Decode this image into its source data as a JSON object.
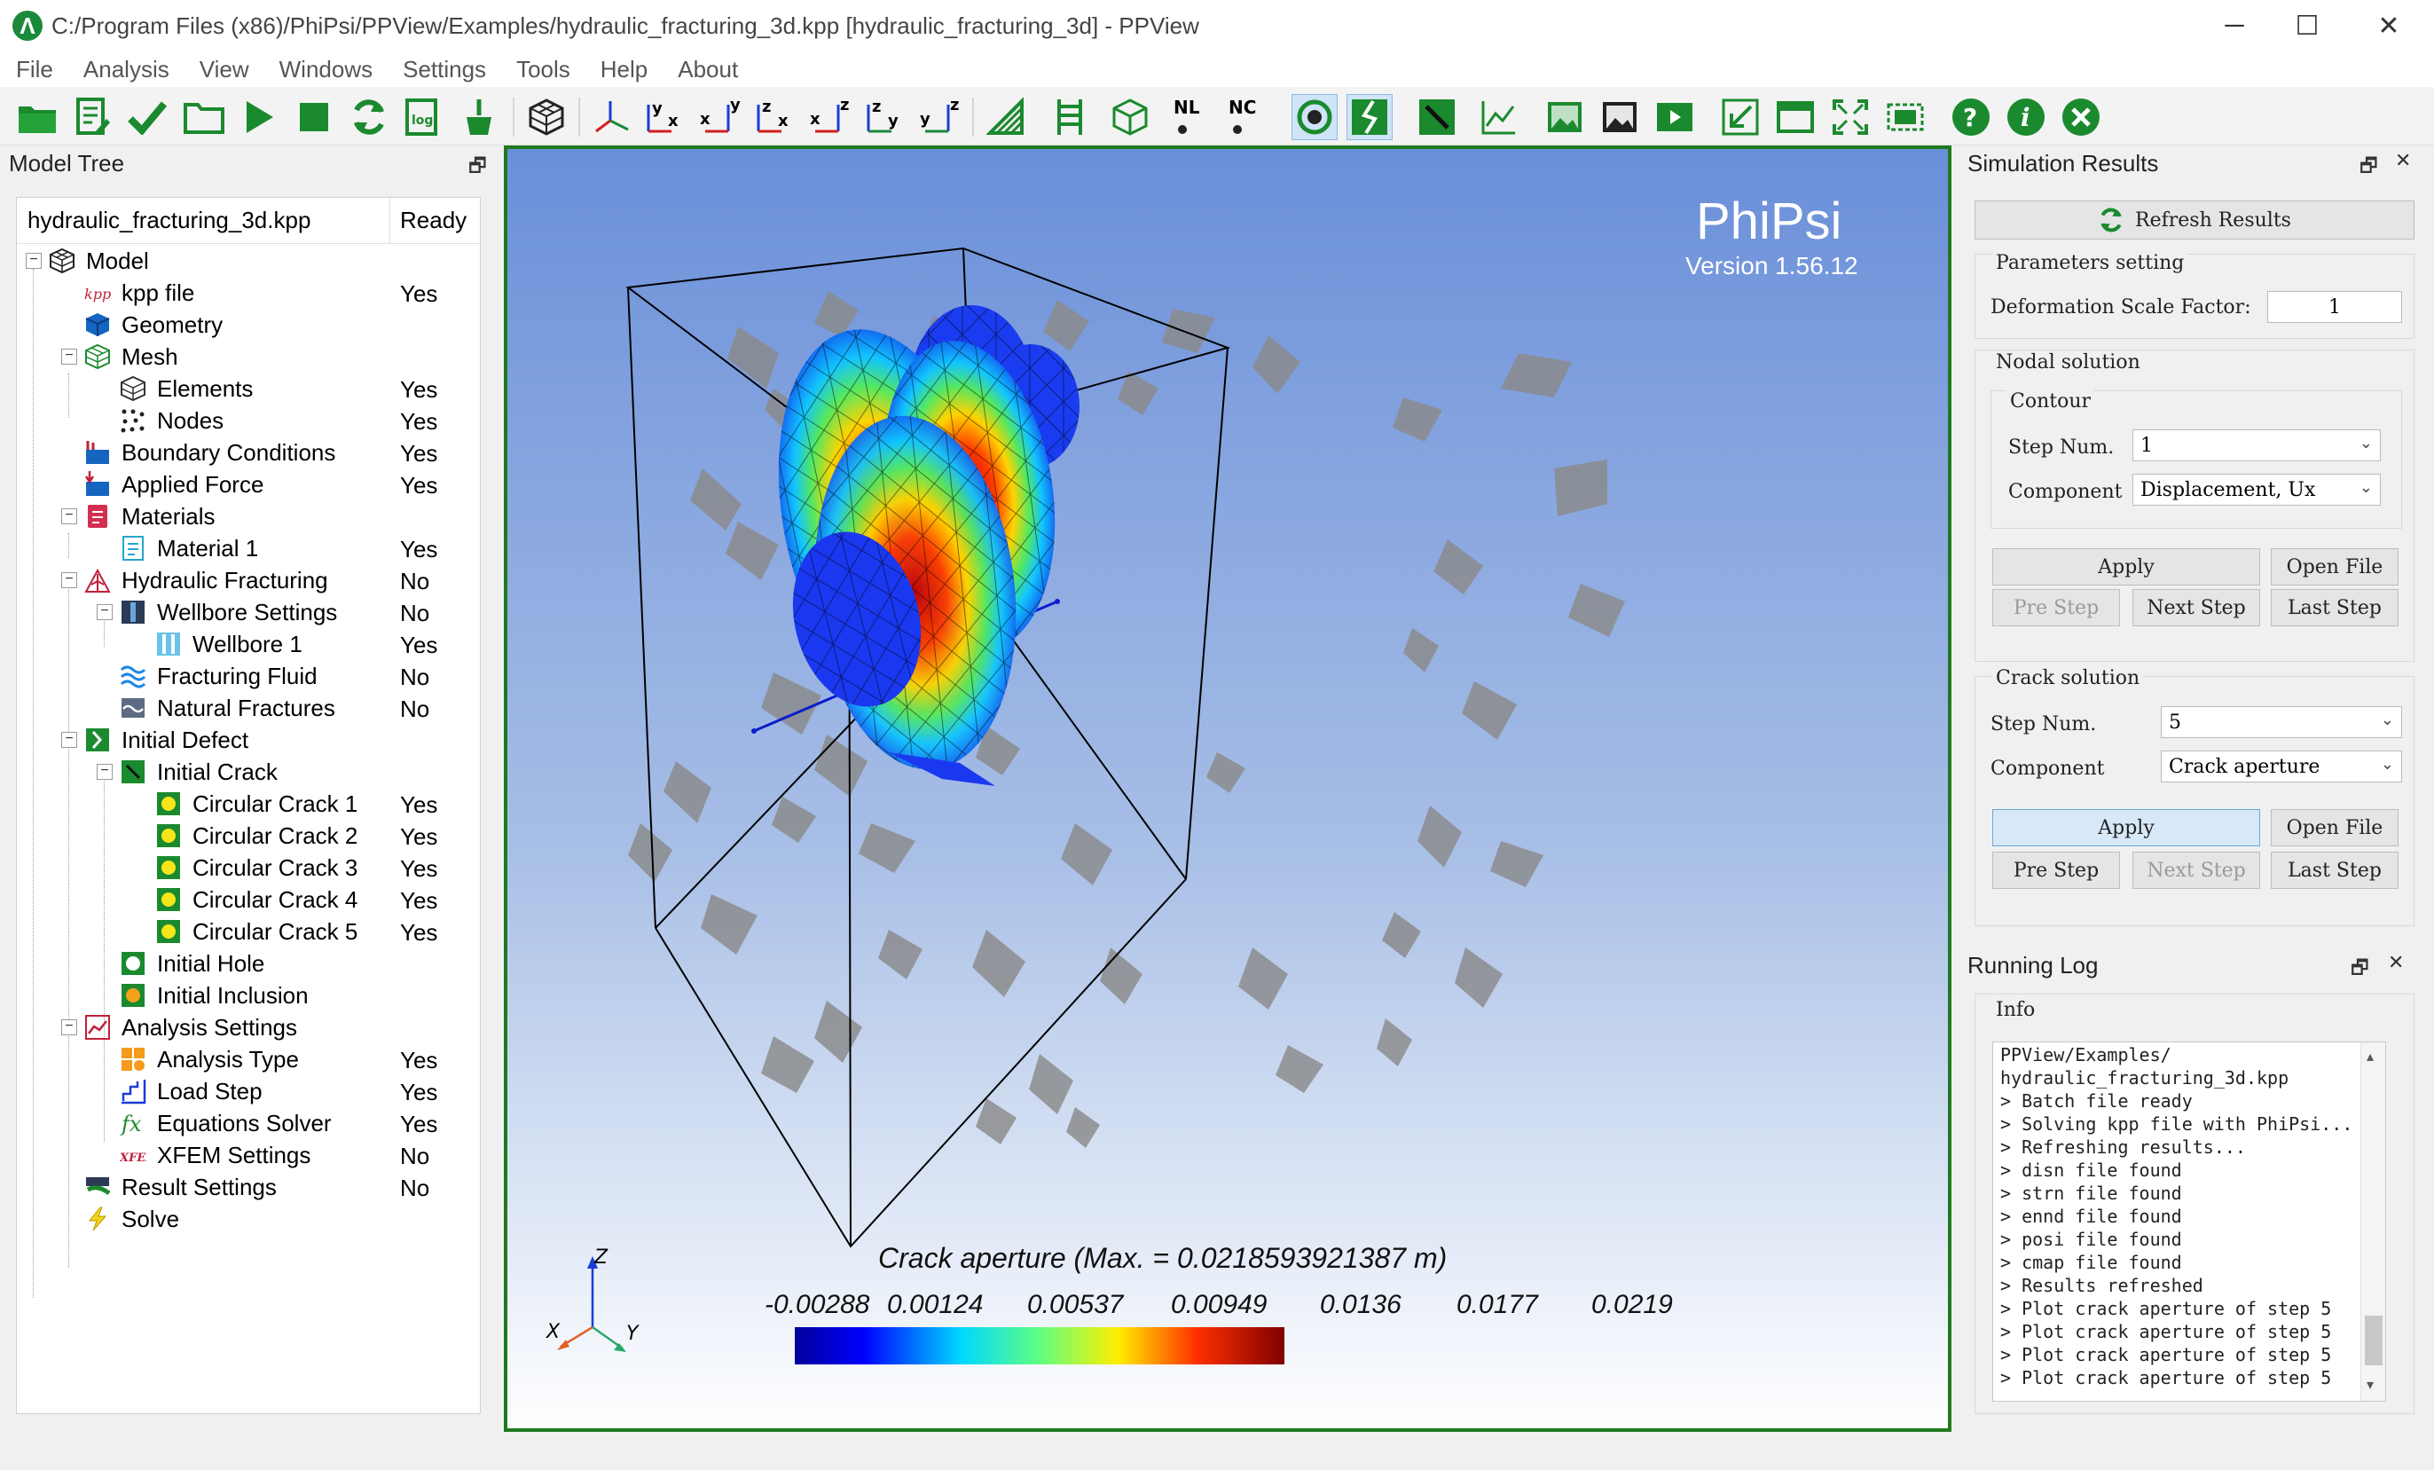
{
  "window": {
    "title": "C:/Program Files (x86)/PhiPsi/PPView/Examples/hydraulic_fracturing_3d.kpp [hydraulic_fracturing_3d] - PPView",
    "minimize": "─",
    "maximize": "☐",
    "close": "✕"
  },
  "menu": [
    "File",
    "Analysis",
    "View",
    "Windows",
    "Settings",
    "Tools",
    "Help",
    "About"
  ],
  "toolbar": {
    "axis_labels": [
      "y x",
      "x y",
      "z x",
      "x z",
      "z y",
      "y z"
    ],
    "nl": "NL",
    "nc": "NC"
  },
  "model_tree": {
    "title": "Model Tree",
    "float_icon": "🗗",
    "header_name": "hydraulic_fracturing_3d.kpp",
    "header_status": "Ready",
    "items": [
      {
        "label": "Model",
        "status": ""
      },
      {
        "label": "kpp file",
        "status": "Yes"
      },
      {
        "label": "Geometry",
        "status": ""
      },
      {
        "label": "Mesh",
        "status": ""
      },
      {
        "label": "Elements",
        "status": "Yes"
      },
      {
        "label": "Nodes",
        "status": "Yes"
      },
      {
        "label": "Boundary Conditions",
        "status": "Yes"
      },
      {
        "label": "Applied Force",
        "status": "Yes"
      },
      {
        "label": "Materials",
        "status": ""
      },
      {
        "label": "Material 1",
        "status": "Yes"
      },
      {
        "label": "Hydraulic Fracturing",
        "status": "No"
      },
      {
        "label": "Wellbore Settings",
        "status": "No"
      },
      {
        "label": "Wellbore 1",
        "status": "Yes"
      },
      {
        "label": "Fracturing Fluid",
        "status": "No"
      },
      {
        "label": "Natural Fractures",
        "status": "No"
      },
      {
        "label": "Initial Defect",
        "status": ""
      },
      {
        "label": "Initial Crack",
        "status": ""
      },
      {
        "label": "Circular Crack 1",
        "status": "Yes"
      },
      {
        "label": "Circular Crack 2",
        "status": "Yes"
      },
      {
        "label": "Circular Crack 3",
        "status": "Yes"
      },
      {
        "label": "Circular Crack 4",
        "status": "Yes"
      },
      {
        "label": "Circular Crack 5",
        "status": "Yes"
      },
      {
        "label": "Initial Hole",
        "status": ""
      },
      {
        "label": "Initial Inclusion",
        "status": ""
      },
      {
        "label": "Analysis Settings",
        "status": ""
      },
      {
        "label": "Analysis Type",
        "status": "Yes"
      },
      {
        "label": "Load Step",
        "status": "Yes"
      },
      {
        "label": "Equations Solver",
        "status": "Yes"
      },
      {
        "label": "XFEM Settings",
        "status": "No"
      },
      {
        "label": "Result Settings",
        "status": "No"
      },
      {
        "label": "Solve",
        "status": ""
      }
    ]
  },
  "viewport": {
    "brand": "PhiPsi",
    "version": "Version 1.56.12",
    "plot_title": "Crack aperture (Max. = 0.0218593921387 m)",
    "colorbar_ticks": [
      "-0.00288",
      "0.00124",
      "0.00537",
      "0.00949",
      "0.0136",
      "0.0177",
      "0.0219"
    ],
    "axes": {
      "x": "X",
      "y": "Y",
      "z": "Z"
    }
  },
  "sim_results": {
    "title": "Simulation Results",
    "refresh": "Refresh Results",
    "params_group": "Parameters setting",
    "deform_label": "Deformation Scale Factor:",
    "deform_value": "1",
    "nodal_group": "Nodal solution",
    "contour_group": "Contour",
    "nodal_step_label": "Step Num.",
    "nodal_step_value": "1",
    "nodal_comp_label": "Component",
    "nodal_comp_value": "Displacement, Ux",
    "crack_group": "Crack solution",
    "crack_step_label": "Step Num.",
    "crack_step_value": "5",
    "crack_comp_label": "Component",
    "crack_comp_value": "Crack aperture",
    "apply": "Apply",
    "open_file": "Open File",
    "pre_step": "Pre Step",
    "next_step": "Next Step",
    "last_step": "Last Step"
  },
  "running_log": {
    "title": "Running Log",
    "group": "Info",
    "lines": [
      "PPView/Examples/",
      "hydraulic_fracturing_3d.kpp",
      " > Batch file ready",
      " > Solving kpp file with PhiPsi...",
      " > Refreshing results...",
      " > disn file found",
      " > strn file found",
      " > ennd file found",
      " > posi file found",
      " > cmap file found",
      " > Results refreshed",
      " > Plot crack aperture of step 5",
      " > Plot crack aperture of step 5",
      " > Plot crack aperture of step 5",
      " > Plot crack aperture of step 5"
    ]
  }
}
